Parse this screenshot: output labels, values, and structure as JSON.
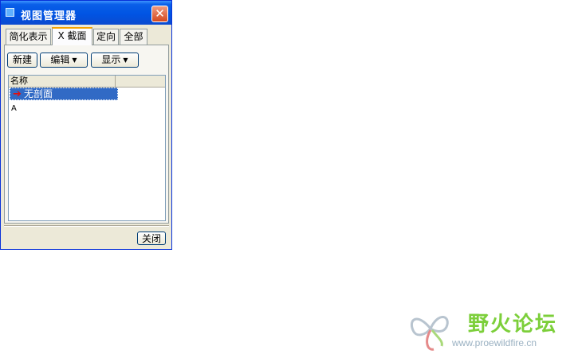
{
  "window": {
    "title": "视图管理器",
    "close_glyph": "✕"
  },
  "tabs": [
    {
      "label": "简化表示"
    },
    {
      "label": "X 截面",
      "active": true
    },
    {
      "label": "定向"
    },
    {
      "label": "全部"
    }
  ],
  "toolbar": {
    "new_label": "新建",
    "edit_label": "编辑",
    "display_label": "显示",
    "dropdown_glyph": "▼"
  },
  "list": {
    "column_name": "名称",
    "items": [
      {
        "label": "无剖面",
        "selected": true,
        "icon": "red-arrow-icon"
      },
      {
        "label": "A",
        "selected": false
      }
    ]
  },
  "footer": {
    "close_label": "关闭"
  },
  "watermark": {
    "title": "野火论坛",
    "url": "www.proewildfire.cn"
  },
  "colors": {
    "titlebar": "#0054e3",
    "selection": "#316ac5",
    "active_tab_accent": "#f5a300",
    "watermark_green": "#7ccf3a"
  }
}
